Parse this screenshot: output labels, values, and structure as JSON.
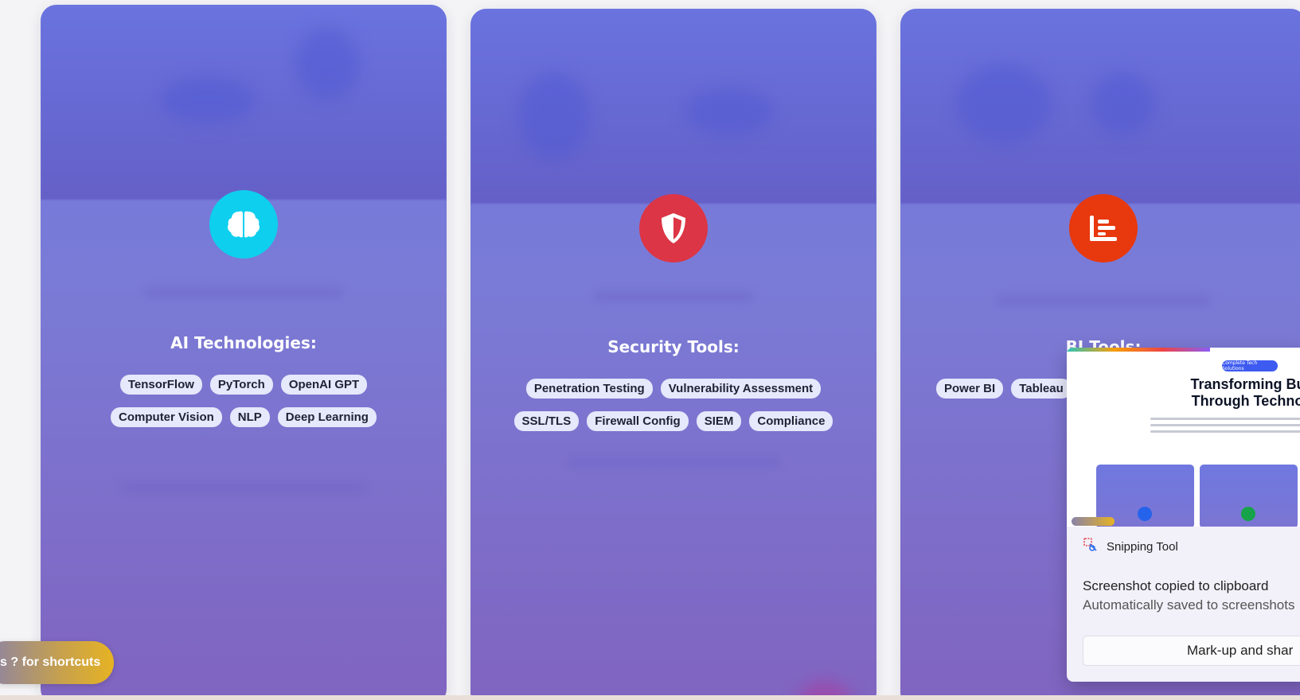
{
  "cards": [
    {
      "id": "ai",
      "icon": "brain-icon",
      "icon_color": "#0ecfee",
      "tools_title": "AI Technologies:",
      "tag_rows": [
        [
          "TensorFlow",
          "PyTorch",
          "OpenAI GPT"
        ],
        [
          "Computer Vision",
          "NLP",
          "Deep Learning"
        ]
      ]
    },
    {
      "id": "security",
      "icon": "shield-icon",
      "icon_color": "#dc3545",
      "tools_title": "Security Tools:",
      "tag_rows": [
        [
          "Penetration Testing",
          "Vulnerability Assessment"
        ],
        [
          "SSL/TLS",
          "Firewall Config",
          "SIEM",
          "Compliance"
        ]
      ]
    },
    {
      "id": "bi",
      "icon": "bar-chart-icon",
      "icon_color": "#e8380d",
      "tools_title": "BI Tools:",
      "tag_rows": [
        [
          "Power BI",
          "Tableau"
        ]
      ]
    }
  ],
  "shortcut_hint": "s ? for shortcuts",
  "toast": {
    "app_name": "Snipping Tool",
    "message": "Screenshot copied to clipboard",
    "sub_message": "Automatically saved to screenshots",
    "button_label": "Mark-up and shar",
    "preview_badge": "Complete Tech Solutions",
    "preview_title_line1": "Transforming Busi",
    "preview_title_line2": "Through Technolo"
  },
  "colors": {
    "card_gradient_top": "#6f78e0",
    "card_gradient_bottom": "#8064c0",
    "tag_bg": "#e6e8fb",
    "shortcut_pill_end": "#e6b323"
  }
}
